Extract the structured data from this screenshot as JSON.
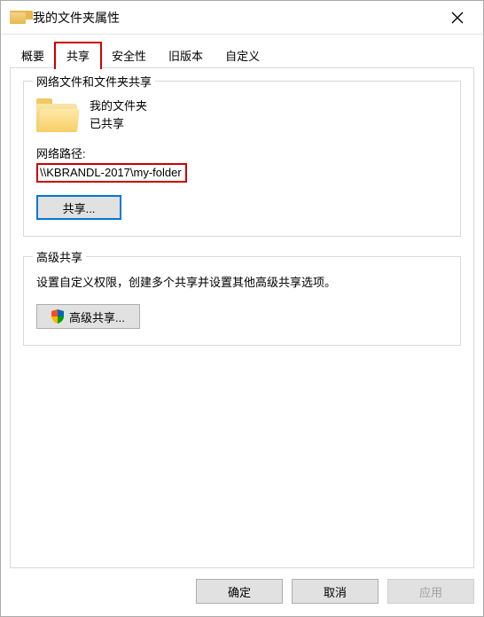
{
  "title": "我的文件夹属性",
  "tabs": {
    "summary": "概要",
    "share": "共享",
    "security": "安全性",
    "previous": "旧版本",
    "custom": "自定义"
  },
  "share_panel": {
    "group1_title": "网络文件和文件夹共享",
    "folder_name": "我的文件夹",
    "share_status": "已共享",
    "netpath_label": "网络路径:",
    "netpath_value": "\\\\KBRANDL-2017\\my-folder",
    "share_button": "共享...",
    "group2_title": "高级共享",
    "group2_desc": "设置自定义权限，创建多个共享并设置其他高级共享选项。",
    "adv_share_button": "高级共享..."
  },
  "footer": {
    "ok": "确定",
    "cancel": "取消",
    "apply": "应用"
  }
}
